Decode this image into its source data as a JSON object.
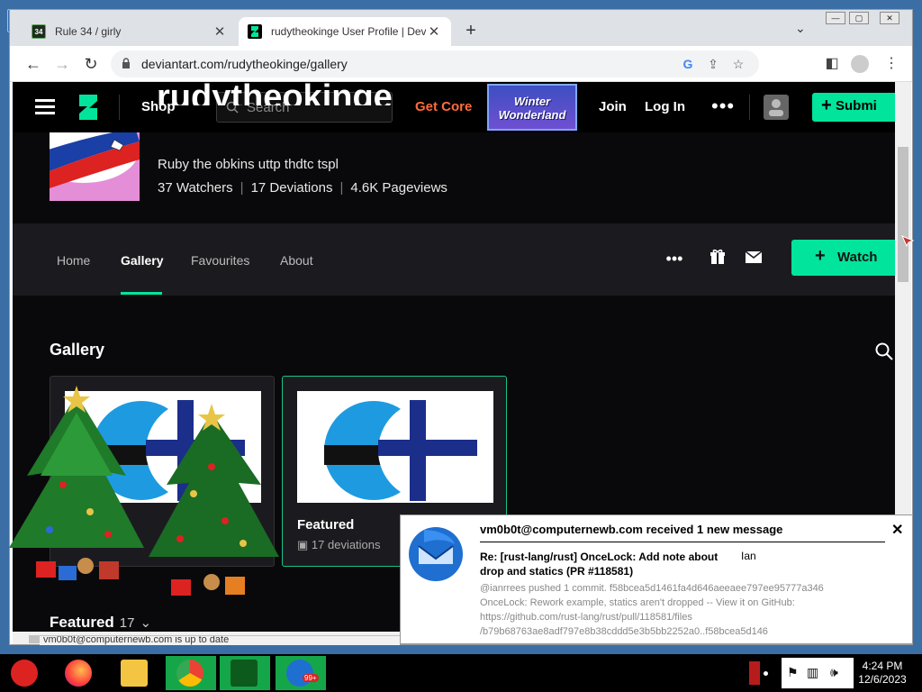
{
  "browser": {
    "tabs": [
      {
        "title": "Rule 34 / girly",
        "favicon": "34",
        "active": false
      },
      {
        "title": "rudytheokinge User Profile | Devi",
        "favicon": "deviantart-icon",
        "active": true
      }
    ],
    "url": "deviantart.com/rudytheokinge/gallery"
  },
  "site": {
    "nav": {
      "shop": "Shop",
      "search_placeholder": "Search",
      "get_core": "Get Core",
      "promo_line1": "Winter",
      "promo_line2": "Wonderland",
      "join": "Join",
      "login": "Log In",
      "more": "•••",
      "submit": "Submi"
    },
    "profile": {
      "name": "rudytheokinge",
      "tagline": "Ruby the obkins uttp thdtc tspl",
      "watchers": "37 Watchers",
      "deviations": "17 Deviations",
      "pageviews": "4.6K Pageviews"
    },
    "subnav": {
      "tabs": [
        "Home",
        "Gallery",
        "Favourites",
        "About"
      ],
      "active": "Gallery",
      "watch": "Watch"
    },
    "gallery": {
      "heading": "Gallery",
      "cards": [
        {
          "title": "",
          "count": ""
        },
        {
          "title": "Featured",
          "count": "17 deviations"
        }
      ],
      "featured_label": "Featured",
      "featured_count": "17"
    }
  },
  "notification": {
    "header": "vm0b0t@computernewb.com received 1 new message",
    "subject": "Re: [rust-lang/rust] OnceLock: Add note about drop and statics (PR #118581)",
    "sender": "Ian",
    "body_lines": [
      "@ianrrees pushed 1 commit. f58bcea5d1461fa4d646aeeaee797ee95777a346",
      "OnceLock: Rework example, statics aren't dropped -- View it on GitHub:",
      "https://github.com/rust-lang/rust/pull/118581/files",
      "/b79b68763ae8adf797e8b38cddd5e3b5bb2252a0..f58bcea5d146"
    ]
  },
  "status_bar": "vm0b0t@computernewb.com is up to date",
  "taskbar": {
    "time": "4:24 PM",
    "date": "12/6/2023",
    "apps": [
      "santa-start-icon",
      "firefox-icon",
      "file-explorer-icon",
      "chrome-icon",
      "christmas-tree-icon",
      "thunderbird-icon"
    ],
    "thunderbird_badge": "99+"
  },
  "colors": {
    "accent_green": "#00e59b",
    "get_core_orange": "#ff6b3b",
    "page_bg": "#09090b"
  }
}
